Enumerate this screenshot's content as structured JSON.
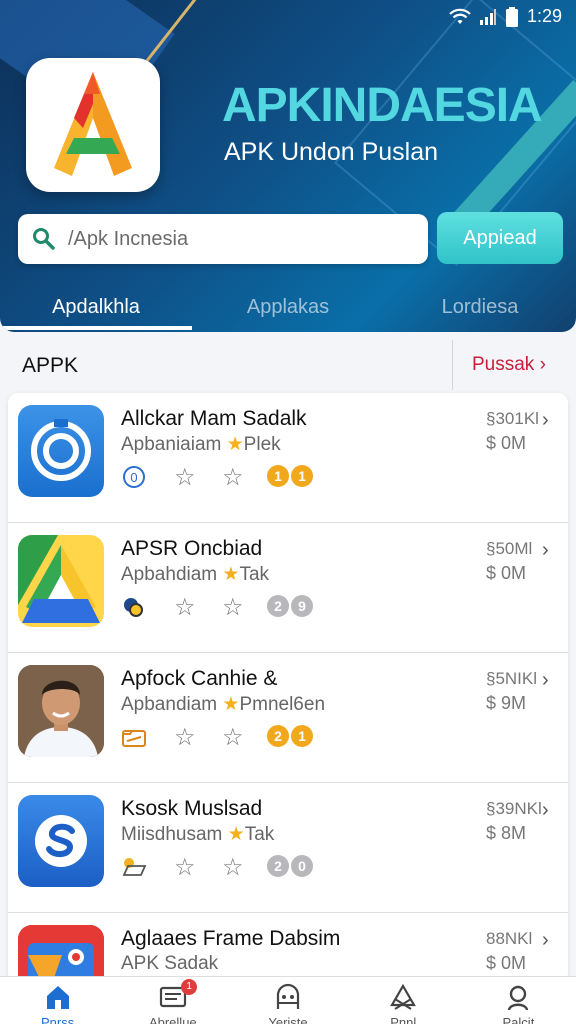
{
  "status_bar": {
    "time": "1:29"
  },
  "header": {
    "title": "APKINDAESIA",
    "subtitle": "APK Undon Puslan",
    "search": {
      "placeholder": "/Apk Incnesia"
    },
    "apply_label": "Appiead",
    "tabs": [
      {
        "label": "Apdalkhla",
        "active": true
      },
      {
        "label": "Applakas",
        "active": false
      },
      {
        "label": "Lordiesa",
        "active": false
      }
    ]
  },
  "section": {
    "title": "APPK",
    "more_label": "Pussak"
  },
  "apps": [
    {
      "name": "Allckar Mam Sadalk",
      "category": "Apbaniaiam",
      "tag": "Plek",
      "meta1": "§301Kl",
      "meta2": "$ 0M",
      "pills": [
        "1",
        "1"
      ],
      "pill_color": "gold",
      "icon": "target-icon"
    },
    {
      "name": "APSR Oncbiad",
      "category": "Apbahdiam",
      "tag": "Tak",
      "meta1": "§50Ml",
      "meta2": "$ 0M",
      "pills": [
        "2",
        "9"
      ],
      "pill_color": "grey",
      "icon": "drive-triangle-icon"
    },
    {
      "name": "Apfock Canhie &",
      "category": "Apbandiam",
      "tag": "Pmnel6en",
      "meta1": "§5NIKl",
      "meta2": "$ 9M",
      "pills": [
        "2",
        "1"
      ],
      "pill_color": "gold",
      "icon": "person-photo"
    },
    {
      "name": "Ksosk Muslsad",
      "category": "Miisdhusam",
      "tag": "Tak",
      "meta1": "§39NKl",
      "meta2": "$ 8M",
      "pills": [
        "2",
        "0"
      ],
      "pill_color": "grey",
      "icon": "sync-s-icon"
    },
    {
      "name": "Aglaaes Frame Dabsim",
      "category": "APK Sadak",
      "tag": "",
      "meta1": "88NKl",
      "meta2": "$ 0M",
      "pills": [],
      "pill_color": "grey",
      "icon": "map-icon"
    }
  ],
  "bottom_nav": [
    {
      "label": "Pnrss",
      "icon": "home-icon",
      "active": true
    },
    {
      "label": "Abrellue",
      "icon": "news-icon",
      "active": false,
      "badge": "1"
    },
    {
      "label": "Yeriste",
      "icon": "robot-icon",
      "active": false
    },
    {
      "label": "Pnnl",
      "icon": "tools-icon",
      "active": false
    },
    {
      "label": "Palcit",
      "icon": "search-icon",
      "active": false
    }
  ],
  "colors": {
    "brand_cyan": "#53d7e0",
    "link_red": "#c81f3b",
    "star_gold": "#f4b01f",
    "nav_active": "#1c6fd1"
  }
}
